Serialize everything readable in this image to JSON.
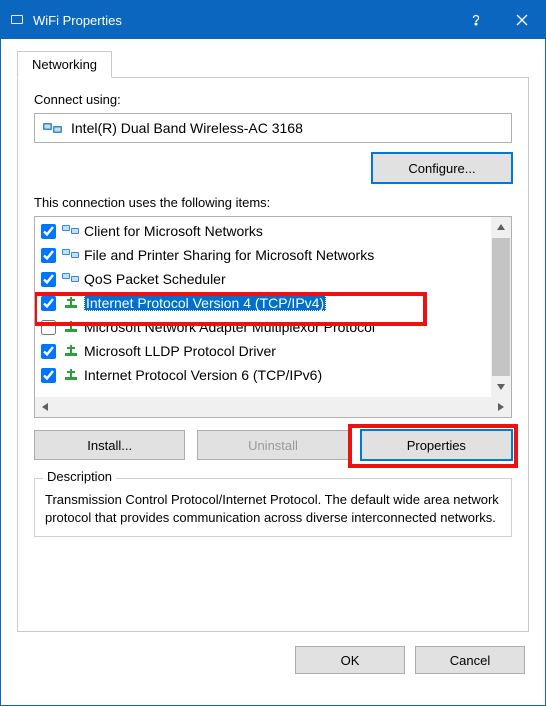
{
  "window": {
    "title": "WiFi Properties"
  },
  "tab": {
    "networking": "Networking"
  },
  "connect_using_label": "Connect using:",
  "adapter": {
    "name": "Intel(R) Dual Band Wireless-AC 3168"
  },
  "configure_btn": "Configure...",
  "items_label": "This connection uses the following items:",
  "items": [
    {
      "checked": true,
      "label": "Client for Microsoft Networks",
      "icon": "client"
    },
    {
      "checked": true,
      "label": "File and Printer Sharing for Microsoft Networks",
      "icon": "client"
    },
    {
      "checked": true,
      "label": "QoS Packet Scheduler",
      "icon": "client"
    },
    {
      "checked": true,
      "label": "Internet Protocol Version 4 (TCP/IPv4)",
      "icon": "protocol",
      "selected": true
    },
    {
      "checked": false,
      "label": "Microsoft Network Adapter Multiplexor Protocol",
      "icon": "protocol"
    },
    {
      "checked": true,
      "label": "Microsoft LLDP Protocol Driver",
      "icon": "protocol"
    },
    {
      "checked": true,
      "label": "Internet Protocol Version 6 (TCP/IPv6)",
      "icon": "protocol"
    }
  ],
  "buttons": {
    "install": "Install...",
    "uninstall": "Uninstall",
    "properties": "Properties",
    "ok": "OK",
    "cancel": "Cancel"
  },
  "description": {
    "legend": "Description",
    "text": "Transmission Control Protocol/Internet Protocol. The default wide area network protocol that provides communication across diverse interconnected networks."
  }
}
